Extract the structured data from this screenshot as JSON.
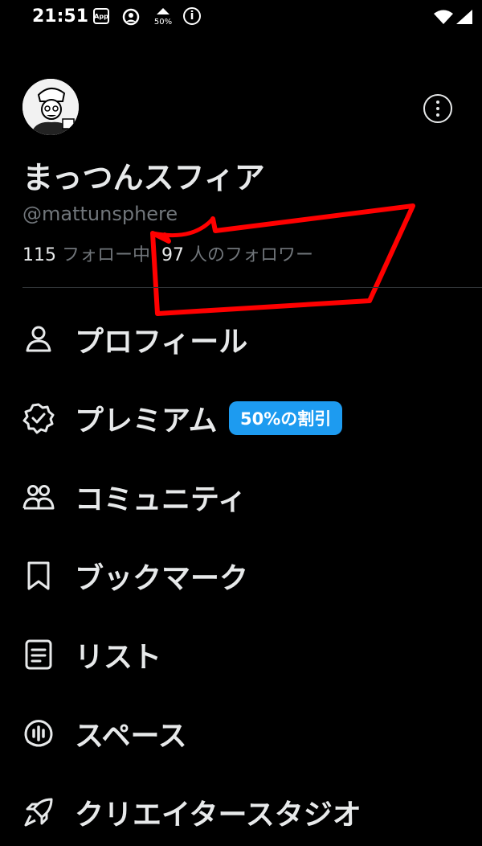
{
  "status_bar": {
    "time": "21:51",
    "app_icon_text": "App",
    "data_saver_text": "50%",
    "icons": [
      "app-notification-icon",
      "vpn-icon",
      "data-saver-icon",
      "info-icon",
      "wifi-icon",
      "signal-icon"
    ]
  },
  "profile": {
    "display_name": "まっつんスフィア",
    "handle": "@mattunsphere",
    "following_count": "115",
    "following_label": "フォロー中",
    "followers_count": "97",
    "followers_label": "人のフォロワー"
  },
  "menu": {
    "items": [
      {
        "label": "プロフィール",
        "icon": "person-icon"
      },
      {
        "label": "プレミアム",
        "icon": "verified-badge-icon",
        "badge": "50%の割引"
      },
      {
        "label": "コミュニティ",
        "icon": "communities-icon"
      },
      {
        "label": "ブックマーク",
        "icon": "bookmark-icon"
      },
      {
        "label": "リスト",
        "icon": "list-icon"
      },
      {
        "label": "スペース",
        "icon": "spaces-icon"
      },
      {
        "label": "クリエイタースタジオ",
        "icon": "rocket-icon"
      }
    ]
  },
  "colors": {
    "background": "#000000",
    "text_primary": "#e7e9ea",
    "text_secondary": "#71767b",
    "accent": "#1d9bf0",
    "annotation": "#ff0000"
  }
}
